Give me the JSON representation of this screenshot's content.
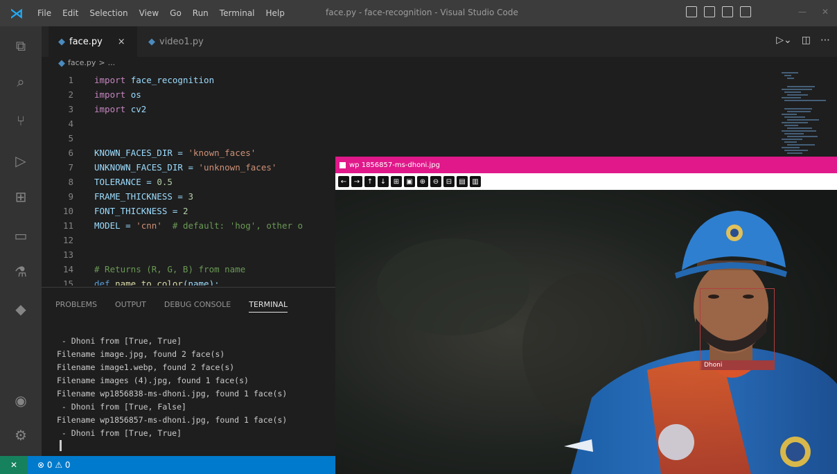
{
  "titlebar": {
    "menu": [
      "File",
      "Edit",
      "Selection",
      "View",
      "Go",
      "Run",
      "Terminal",
      "Help"
    ],
    "title": "face.py - face-recognition - Visual Studio Code"
  },
  "tabs": [
    {
      "label": "face.py",
      "close": "×"
    },
    {
      "label": "video1.py"
    }
  ],
  "breadcrumb": [
    "face.py",
    ">",
    "..."
  ],
  "editor": {
    "lines": [
      {
        "n": "1",
        "code": [
          [
            "kw",
            "import "
          ],
          [
            "plain",
            "face_recognition"
          ]
        ]
      },
      {
        "n": "2",
        "code": [
          [
            "kw",
            "import "
          ],
          [
            "plain",
            "os"
          ]
        ]
      },
      {
        "n": "3",
        "code": [
          [
            "kw",
            "import "
          ],
          [
            "plain",
            "cv2"
          ]
        ]
      },
      {
        "n": "4",
        "code": []
      },
      {
        "n": "5",
        "code": []
      },
      {
        "n": "6",
        "code": [
          [
            "plain",
            "KNOWN_FACES_DIR = "
          ],
          [
            "str",
            "'known_faces'"
          ]
        ]
      },
      {
        "n": "7",
        "code": [
          [
            "plain",
            "UNKNOWN_FACES_DIR = "
          ],
          [
            "str",
            "'unknown_faces'"
          ]
        ]
      },
      {
        "n": "8",
        "code": [
          [
            "plain",
            "TOLERANCE = "
          ],
          [
            "num",
            "0.5"
          ]
        ]
      },
      {
        "n": "9",
        "code": [
          [
            "plain",
            "FRAME_THICKNESS = "
          ],
          [
            "num",
            "3"
          ]
        ]
      },
      {
        "n": "10",
        "code": [
          [
            "plain",
            "FONT_THICKNESS = "
          ],
          [
            "num",
            "2"
          ]
        ]
      },
      {
        "n": "11",
        "code": [
          [
            "plain",
            "MODEL = "
          ],
          [
            "str",
            "'cnn'"
          ],
          [
            "cmt",
            "  # default: 'hog', other o"
          ]
        ]
      },
      {
        "n": "12",
        "code": []
      },
      {
        "n": "13",
        "code": []
      },
      {
        "n": "14",
        "code": [
          [
            "cmt",
            "# Returns (R, G, B) from name"
          ]
        ]
      },
      {
        "n": "15",
        "code": [
          [
            "def",
            "def "
          ],
          [
            "fn",
            "name_to_color"
          ],
          [
            "plain",
            "(name):"
          ]
        ]
      }
    ]
  },
  "panel": {
    "tabs": [
      "PROBLEMS",
      "OUTPUT",
      "DEBUG CONSOLE",
      "TERMINAL"
    ],
    "active_tab": "TERMINAL",
    "terminal_lines": [
      " - Dhoni from [True, True]",
      "Filename image.jpg, found 2 face(s)",
      "Filename image1.webp, found 2 face(s)",
      "Filename images (4).jpg, found 1 face(s)",
      "Filename wp1856838-ms-dhoni.jpg, found 1 face(s)",
      " - Dhoni from [True, False]",
      "Filename wp1856857-ms-dhoni.jpg, found 1 face(s)",
      " - Dhoni from [True, True]"
    ]
  },
  "statusbar": {
    "remote": "✕",
    "problems": "⊗ 0 ⚠ 0"
  },
  "viewer": {
    "title": "wp 1856857-ms-dhoni.jpg",
    "toolbar": [
      "←",
      "→",
      "↑",
      "↓",
      "⊞",
      "▣",
      "⊕",
      "⊖",
      "⊟",
      "▤",
      "▥"
    ],
    "face_label": "Dhoni"
  },
  "colors": {
    "titlebar": "#3c3c3c",
    "activitybar": "#333333",
    "editor_bg": "#1e1e1e",
    "statusbar": "#007acc",
    "viewer_title": "#e0188a"
  }
}
